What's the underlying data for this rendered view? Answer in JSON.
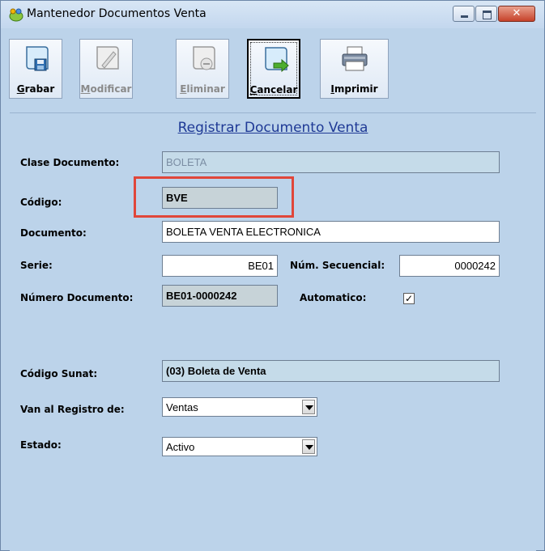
{
  "window": {
    "title": "Mantenedor Documentos Venta",
    "close_glyph": "✕"
  },
  "toolbar": {
    "grabar": "Grabar",
    "modificar": "Modificar",
    "eliminar": "Eliminar",
    "cancelar": "Cancelar",
    "imprimir": "Imprimir"
  },
  "form": {
    "title": "Registrar Documento Venta",
    "clase_documento": {
      "label": "Clase Documento:",
      "value": "BOLETA"
    },
    "codigo": {
      "label": "Código:",
      "value": "BVE"
    },
    "documento": {
      "label": "Documento:",
      "value": "BOLETA VENTA ELECTRONICA"
    },
    "serie": {
      "label": "Serie:",
      "value": "BE01"
    },
    "num_secuencial": {
      "label": "Núm. Secuencial:",
      "value": "0000242"
    },
    "numero_documento": {
      "label": "Número Documento:",
      "value": "BE01-0000242"
    },
    "automatico": {
      "label": "Automatico:",
      "checked": true,
      "check_glyph": "✓"
    },
    "codigo_sunat": {
      "label": "Código Sunat:",
      "value": "(03) Boleta de Venta"
    },
    "registro": {
      "label": "Van al Registro de:",
      "value": "Ventas"
    },
    "estado": {
      "label": "Estado:",
      "value": "Activo"
    }
  },
  "colors": {
    "highlight": "#e0463a",
    "title_link": "#1f3a96",
    "background": "#bcd3ea"
  }
}
